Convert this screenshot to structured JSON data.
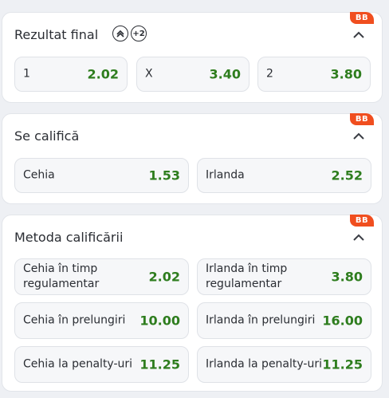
{
  "badge": "BB",
  "sections": [
    {
      "title": "Rezultat final",
      "plus_badge": "+2",
      "odds": [
        {
          "label": "1",
          "value": "2.02"
        },
        {
          "label": "X",
          "value": "3.40"
        },
        {
          "label": "2",
          "value": "3.80"
        }
      ]
    },
    {
      "title": "Se califică",
      "odds": [
        {
          "label": "Cehia",
          "value": "1.53"
        },
        {
          "label": "Irlanda",
          "value": "2.52"
        }
      ]
    },
    {
      "title": "Metoda calificării",
      "odds": [
        {
          "label": "Cehia în timp regulamentar",
          "value": "2.02"
        },
        {
          "label": "Irlanda în timp regulamentar",
          "value": "3.80"
        },
        {
          "label": "Cehia în prelungiri",
          "value": "10.00"
        },
        {
          "label": "Irlanda în prelungiri",
          "value": "16.00"
        },
        {
          "label": "Cehia la penalty-uri",
          "value": "11.25"
        },
        {
          "label": "Irlanda la penalty-uri",
          "value": "11.25"
        }
      ]
    }
  ],
  "colors": {
    "odds_value": "#2e7d1e",
    "badge": "#f04e1f"
  }
}
